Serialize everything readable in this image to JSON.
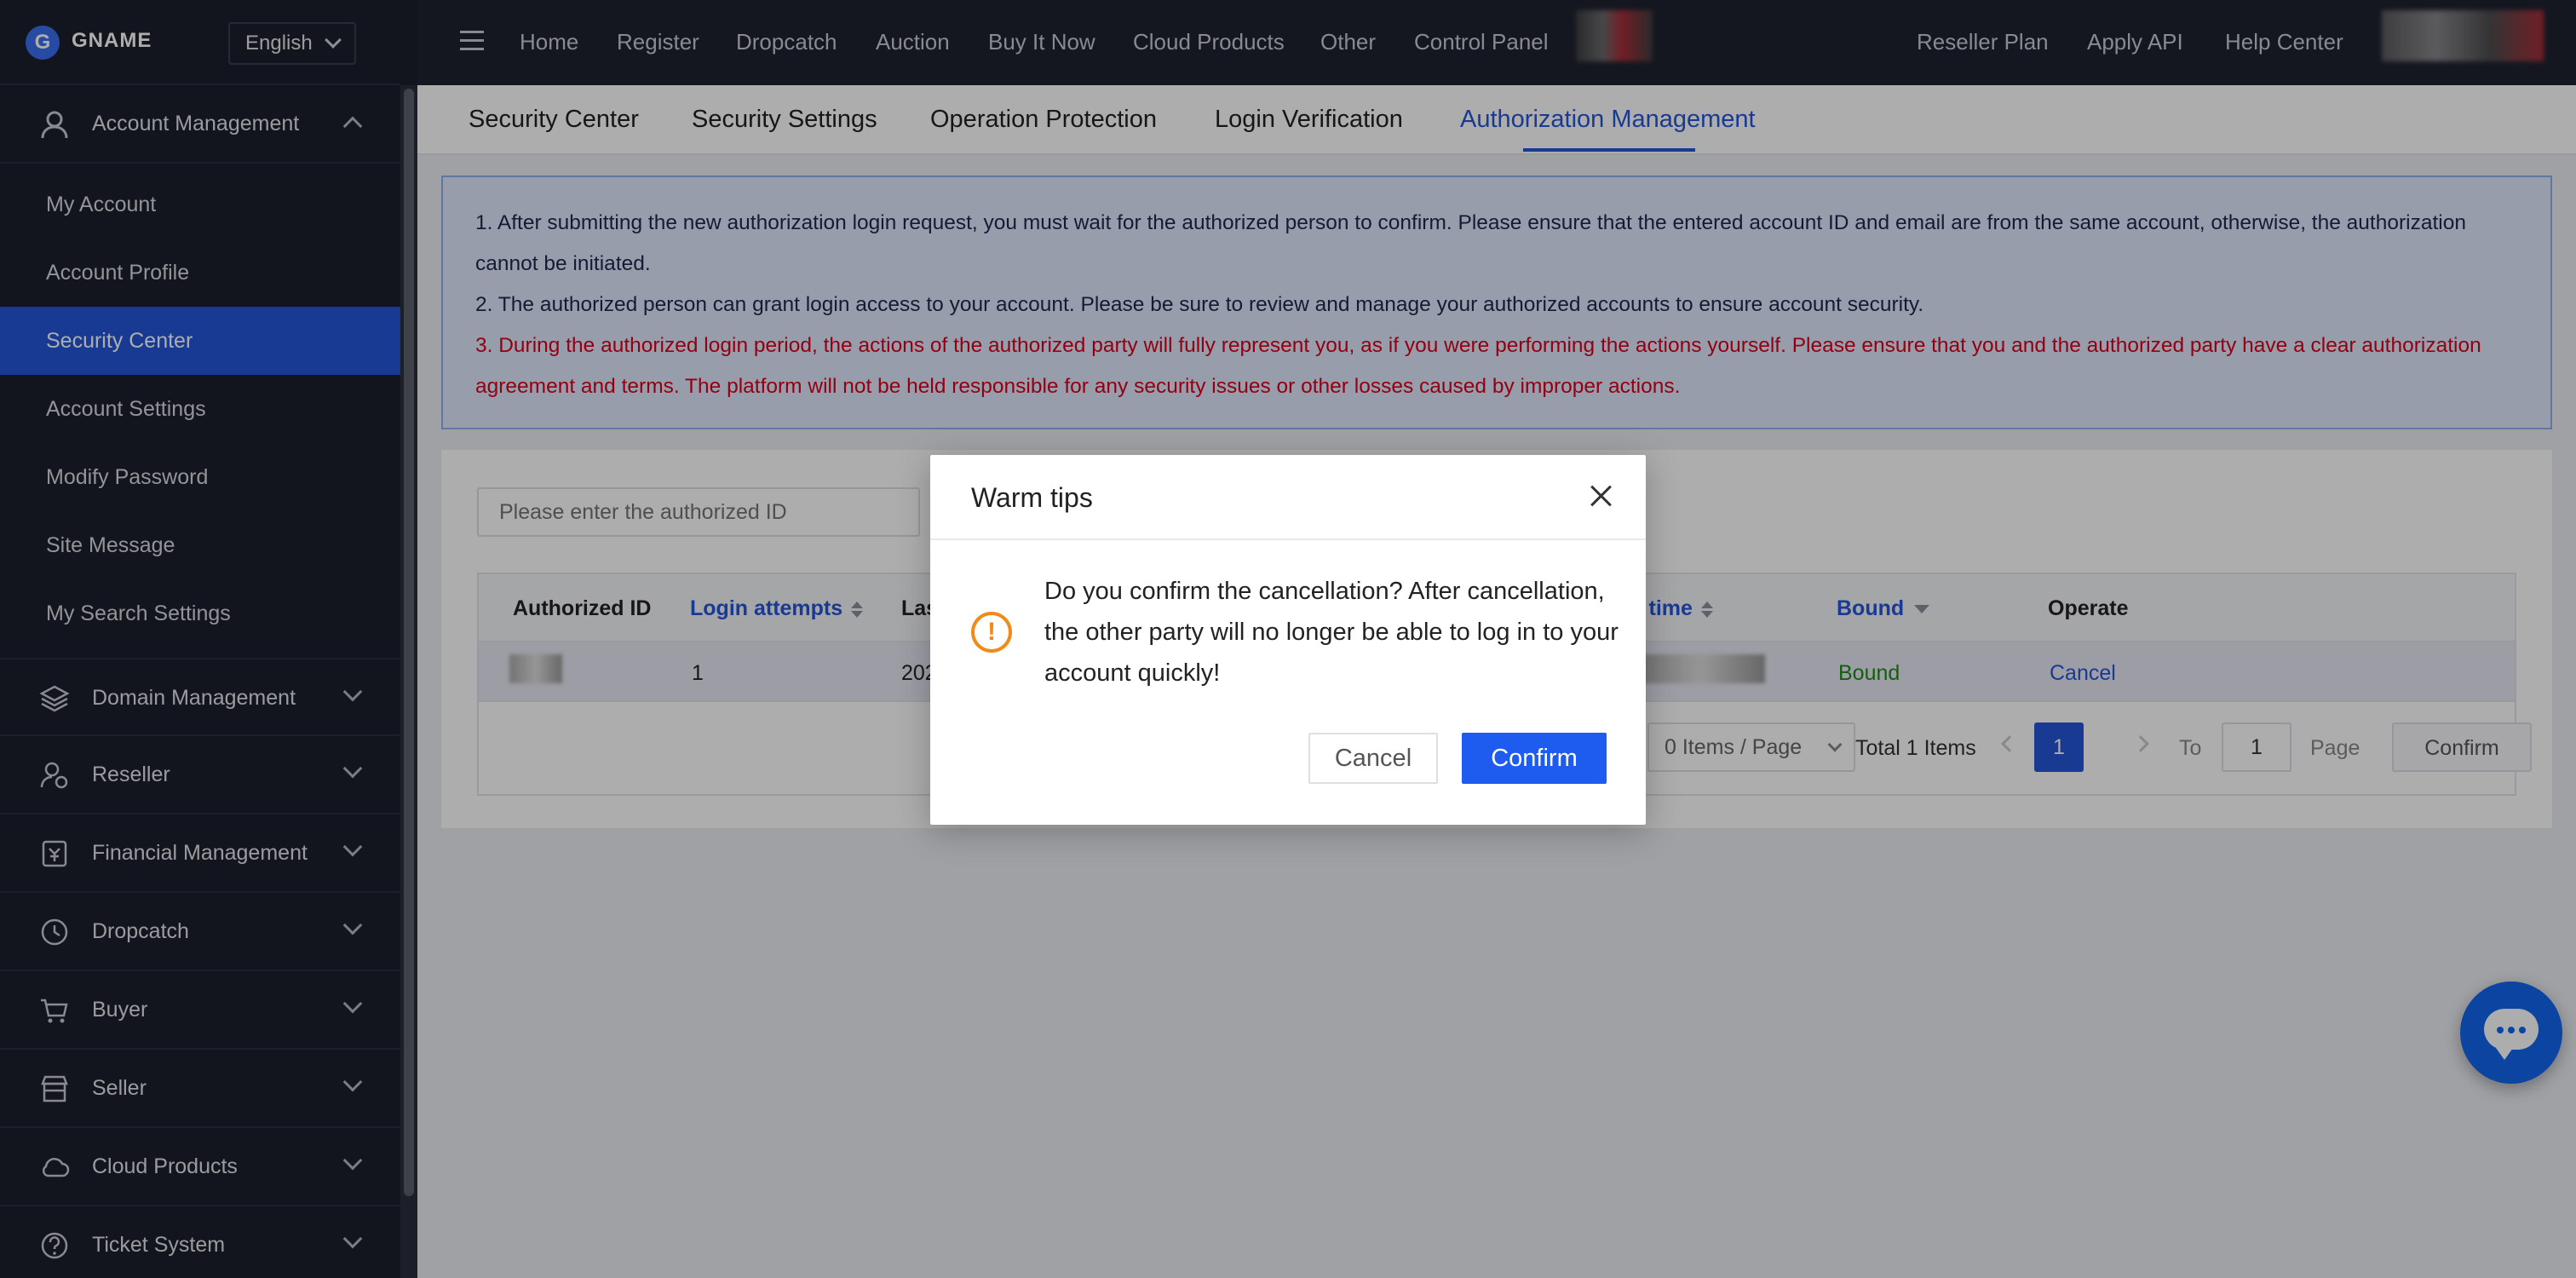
{
  "brand": {
    "name": "GNAME",
    "logo_letter": "G"
  },
  "language": {
    "selected": "English"
  },
  "sidebar": {
    "groups": [
      {
        "label": "Account Management",
        "icon": "user-icon",
        "expanded": true
      },
      {
        "label": "Domain Management",
        "icon": "layers-icon"
      },
      {
        "label": "Reseller",
        "icon": "reseller-icon"
      },
      {
        "label": "Financial Management",
        "icon": "finance-icon"
      },
      {
        "label": "Dropcatch",
        "icon": "clock-icon"
      },
      {
        "label": "Buyer",
        "icon": "cart-icon"
      },
      {
        "label": "Seller",
        "icon": "store-icon"
      },
      {
        "label": "Cloud Products",
        "icon": "cloud-icon"
      },
      {
        "label": "Ticket System",
        "icon": "help-icon"
      }
    ],
    "sub_items": [
      {
        "label": "My Account"
      },
      {
        "label": "Account Profile"
      },
      {
        "label": "Security Center",
        "active": true
      },
      {
        "label": "Account Settings"
      },
      {
        "label": "Modify Password"
      },
      {
        "label": "Site Message"
      },
      {
        "label": "My Search Settings"
      }
    ]
  },
  "topnav": {
    "items": [
      "Home",
      "Register",
      "Dropcatch",
      "Auction",
      "Buy It Now",
      "Cloud Products",
      "Other",
      "Control Panel"
    ],
    "right_items": [
      "Reseller Plan",
      "Apply API",
      "Help Center"
    ]
  },
  "tabs": [
    "Security Center",
    "Security Settings",
    "Operation Protection",
    "Login Verification",
    "Authorization Management"
  ],
  "active_tab": "Authorization Management",
  "notice": {
    "line1": "1. After submitting the new authorization login request, you must wait for the authorized person to confirm. Please ensure that the entered account ID and email are from the same account, otherwise, the authorization cannot be initiated.",
    "line2": "2. The authorized person can grant login access to your account. Please be sure to review and manage your authorized accounts to ensure account security.",
    "line3": "3. During the authorized login period, the actions of the authorized party will fully represent you, as if you were performing the actions yourself. Please ensure that you and the authorized party have a clear authorization agreement and terms. The platform will not be held responsible for any security issues or other losses caused by improper actions."
  },
  "search": {
    "placeholder": "Please enter the authorized ID"
  },
  "table": {
    "headers": {
      "authorized_id": "Authorized ID",
      "login_attempts": "Login attempts",
      "last": "Las",
      "auth_time": "on time",
      "bound": "Bound",
      "operate": "Operate"
    },
    "rows": [
      {
        "login_attempts": "1",
        "last_partial": "202",
        "bound": "Bound",
        "operate": "Cancel"
      }
    ]
  },
  "pagination": {
    "page_size": "0 Items / Page",
    "total": "Total 1 Items",
    "current_page": "1",
    "to_label": "To",
    "jump_value": "1",
    "page_label": "Page",
    "confirm_label": "Confirm"
  },
  "dialog": {
    "title": "Warm tips",
    "message": "Do you confirm the cancellation? After cancellation, the other party will no longer be able to log in to your account quickly!",
    "cancel_label": "Cancel",
    "confirm_label": "Confirm",
    "icon": "warning-icon"
  },
  "colors": {
    "primary": "#2456d9",
    "sidebar_bg": "#1b1f2c",
    "topnav_bg": "#1e2230",
    "warning": "#f28a1a",
    "danger_text": "#d9001b",
    "bound_text": "#1f8a17",
    "chat_fab": "#1366ee"
  }
}
